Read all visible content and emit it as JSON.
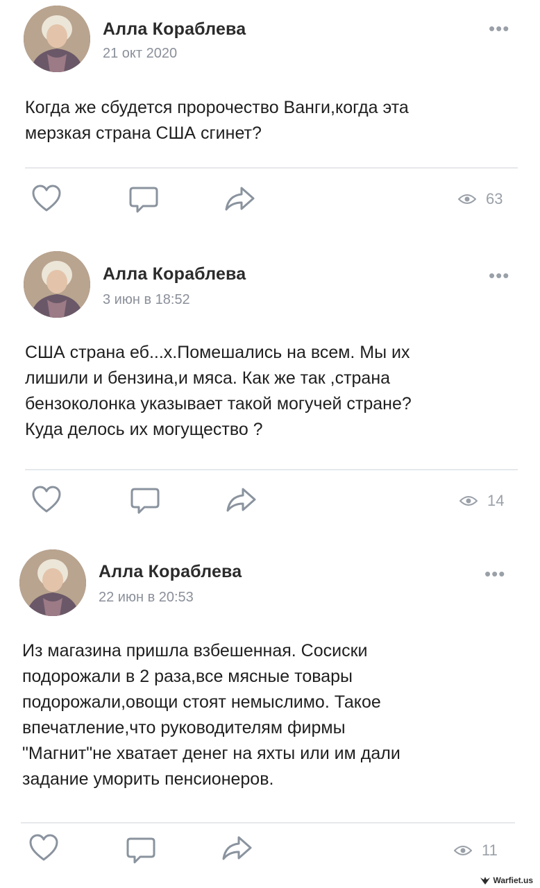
{
  "posts": [
    {
      "author": "Алла Кораблева",
      "date": "21 окт 2020",
      "text_lines": [
        "Когда же сбудется пророчество Ванги,когда эта",
        "мерзкая страна США сгинет?"
      ],
      "views": "63"
    },
    {
      "author": "Алла Кораблева",
      "date": "3 июн в 18:52",
      "text_lines": [
        "США страна еб...х.Помешались на всем. Мы их",
        "лишили и бензина,и мяса. Как же так ,страна",
        "бензоколонка указывает такой могучей стране?",
        "Куда делось их могущество ?"
      ],
      "views": "14"
    },
    {
      "author": "Алла Кораблева",
      "date": "22 июн в 20:53",
      "text_lines": [
        "Из магазина пришла взбешенная. Сосиски",
        "подорожали в 2 раза,все мясные товары",
        "подорожали,овощи стоят немыслимо. Такое",
        "впечатление,что руководителям фирмы",
        "\"Магнит\"не хватает денег на яхты или им дали",
        "задание уморить пенсионеров."
      ],
      "views": "11"
    }
  ],
  "more_label": "•••",
  "icons": {
    "like": "heart-icon",
    "comment": "comment-icon",
    "share": "share-icon",
    "views": "eye-icon"
  },
  "colors": {
    "icon_stroke": "#8a939e",
    "meta_text": "#8a8f99",
    "divider": "#e6e8eb"
  },
  "watermark": "Warfiet.us"
}
